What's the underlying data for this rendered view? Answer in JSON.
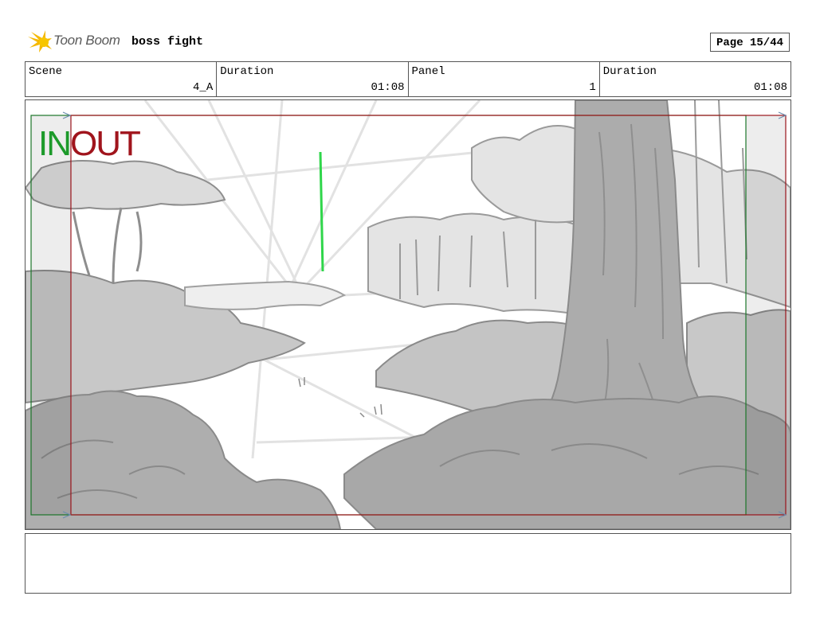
{
  "header": {
    "logo_text": "Toon Boom",
    "project_title": "boss fight",
    "page_label": "Page 15/44"
  },
  "info": {
    "scene_label": "Scene",
    "scene_value": "4_A",
    "scene_duration_label": "Duration",
    "scene_duration_value": "01:08",
    "panel_label": "Panel",
    "panel_value": "1",
    "panel_duration_label": "Duration",
    "panel_duration_value": "01:08"
  },
  "panel": {
    "in_label": "IN",
    "out_label": "OUT"
  },
  "colors": {
    "in_marker": "#1d9a2b",
    "out_marker": "#a0141c",
    "logo_star": "#f5b800"
  },
  "notes": {
    "text": ""
  }
}
